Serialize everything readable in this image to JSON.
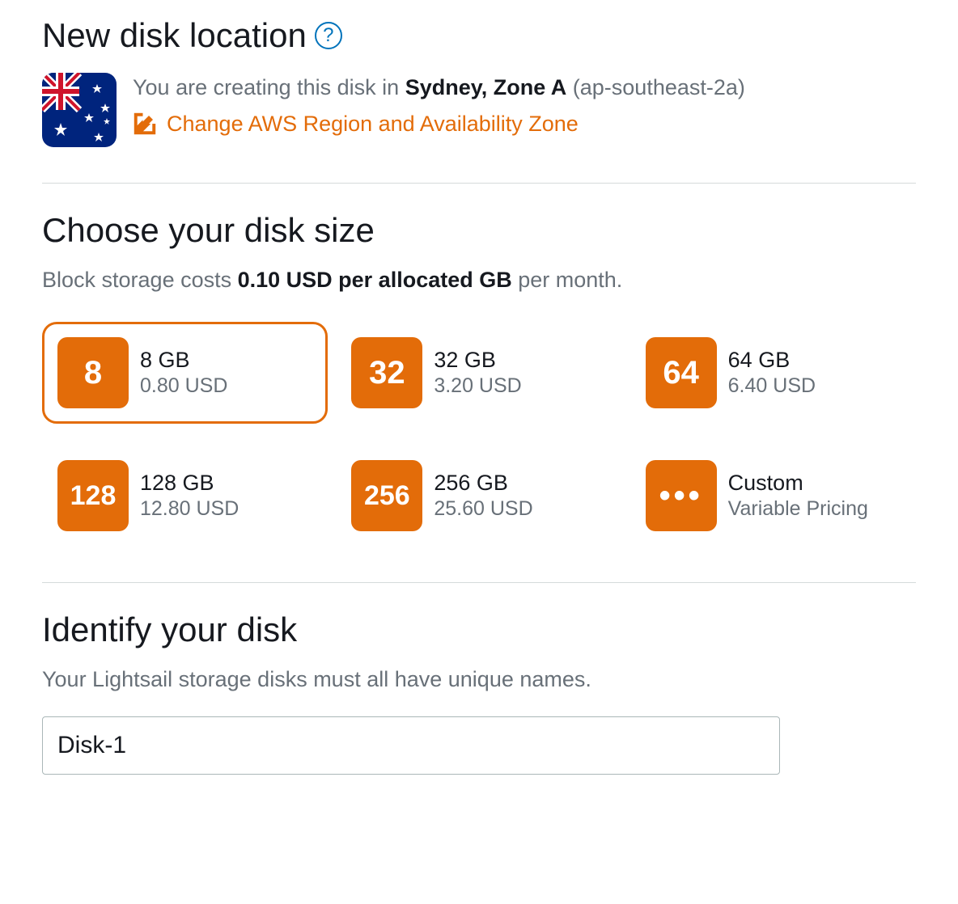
{
  "location": {
    "heading": "New disk location",
    "help_tooltip": "?",
    "creating_prefix": "You are creating this disk in ",
    "region_zone": "Sydney, Zone A",
    "region_code": "(ap-southeast-2a)",
    "change_link": "Change AWS Region and Availability Zone",
    "flag_label": "Australia"
  },
  "disk_size": {
    "heading": "Choose your disk size",
    "desc_prefix": "Block storage costs ",
    "desc_bold": "0.10 USD per allocated GB",
    "desc_suffix": " per month.",
    "options": [
      {
        "badge": "8",
        "title": "8 GB",
        "price": "0.80 USD",
        "selected": true
      },
      {
        "badge": "32",
        "title": "32 GB",
        "price": "3.20 USD",
        "selected": false
      },
      {
        "badge": "64",
        "title": "64 GB",
        "price": "6.40 USD",
        "selected": false
      },
      {
        "badge": "128",
        "title": "128 GB",
        "price": "12.80 USD",
        "selected": false
      },
      {
        "badge": "256",
        "title": "256 GB",
        "price": "25.60 USD",
        "selected": false
      },
      {
        "badge": "•••",
        "title": "Custom",
        "price": "Variable Pricing",
        "selected": false
      }
    ]
  },
  "identify": {
    "heading": "Identify your disk",
    "desc": "Your Lightsail storage disks must all have unique names.",
    "input_value": "Disk-1"
  }
}
